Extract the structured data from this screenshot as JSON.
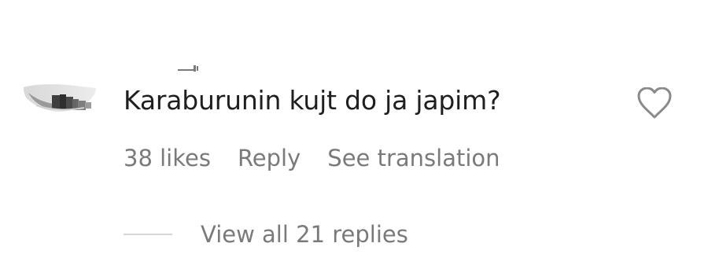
{
  "comment": {
    "text": "Karaburunin kujt do ja japim?",
    "likes_label": "38 likes",
    "reply_label": "Reply",
    "translation_label": "See translation",
    "view_replies_label": "View all 21 replies"
  },
  "icons": {
    "like": "heart-outline-icon"
  },
  "colors": {
    "background": "#ffffff",
    "primary_text": "#1f1f1f",
    "secondary_text": "#7a7a7a",
    "divider": "#d6d6d6",
    "icon": "#8a8a8a"
  }
}
